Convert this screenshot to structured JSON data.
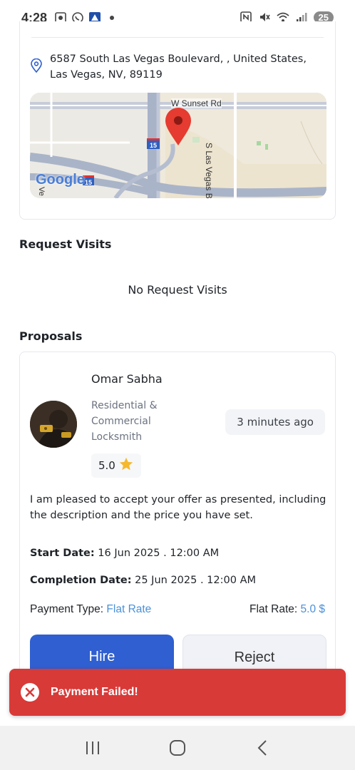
{
  "status_bar": {
    "time": "4:28",
    "battery": "25"
  },
  "address": {
    "text": "6587 South Las Vegas Boulevard, , United States, Las Vegas, NV, 89119"
  },
  "map": {
    "labels": {
      "street_1": "W Sunset Rd",
      "street_2": "S Las Vegas Blvd",
      "highway": "15",
      "highway_2": "15",
      "logo": "Google",
      "edge_text": "Ve"
    }
  },
  "request_visits": {
    "title": "Request Visits",
    "empty_text": "No Request Visits"
  },
  "proposals": {
    "title": "Proposals",
    "items": [
      {
        "provider_name": "Omar Sabha",
        "provider_role": "Residential & Commercial Locksmith",
        "time_ago": "3 minutes ago",
        "rating": "5.0",
        "message": "I am pleased to accept your offer as presented, including the description and the price you have set.",
        "start_date_label": "Start Date:",
        "start_date": "16 Jun 2025 . 12:00 AM",
        "completion_date_label": "Completion Date:",
        "completion_date": "25 Jun 2025 . 12:00 AM",
        "payment_type_label": "Payment Type:",
        "payment_type": "Flat Rate",
        "rate_label": "Flat Rate:",
        "rate_value": "5.0 $",
        "hire_label": "Hire",
        "reject_label": "Reject"
      }
    ]
  },
  "toast": {
    "message": "Payment Failed!"
  },
  "colors": {
    "hire_button": "#2f5fd0",
    "toast_bg": "#d83a38",
    "accent_value": "#4a90d9",
    "star": "#f5b82e"
  }
}
